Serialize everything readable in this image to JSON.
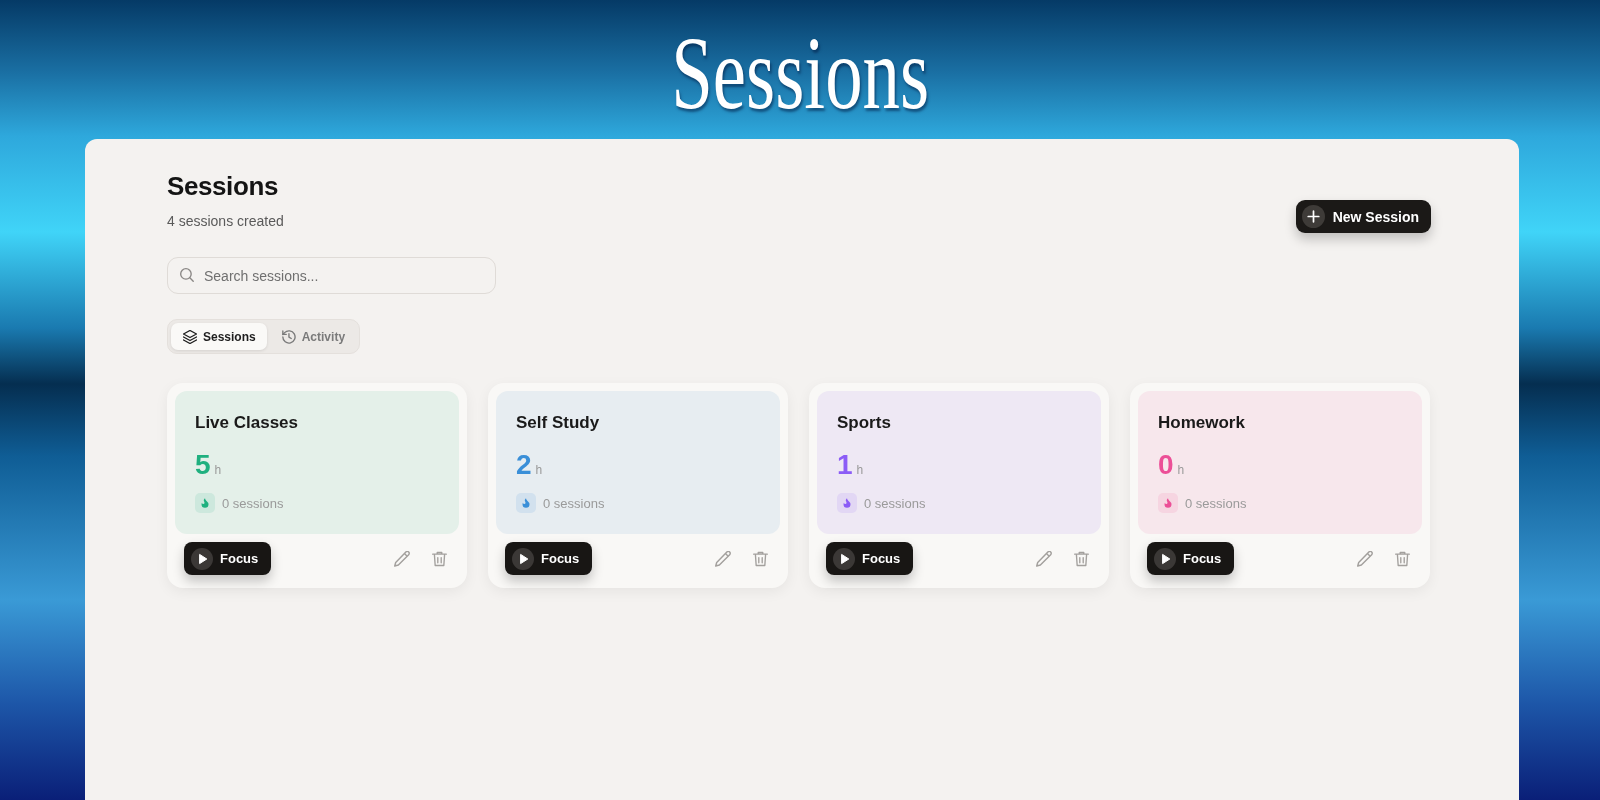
{
  "banner": {
    "title": "Sessions"
  },
  "header": {
    "title": "Sessions",
    "subtitle": "4 sessions created",
    "new_session_button": "New Session"
  },
  "search": {
    "placeholder": "Search sessions..."
  },
  "tabs": [
    {
      "label": "Sessions",
      "kind": "layers",
      "selected": true
    },
    {
      "label": "Activity",
      "kind": "history",
      "selected": false
    }
  ],
  "sessions": [
    {
      "name": "Live Classes",
      "hours": "5",
      "unit": "h",
      "count": "0 sessions",
      "color": "#1fb07f",
      "action": "Focus"
    },
    {
      "name": "Self Study",
      "hours": "2",
      "unit": "h",
      "count": "0 sessions",
      "color": "#3a8fd8",
      "action": "Focus"
    },
    {
      "name": "Sports",
      "hours": "1",
      "unit": "h",
      "count": "0 sessions",
      "color": "#8b5cf6",
      "action": "Focus"
    },
    {
      "name": "Homework",
      "hours": "0",
      "unit": "h",
      "count": "0 sessions",
      "color": "#ec4f97",
      "action": "Focus"
    }
  ]
}
